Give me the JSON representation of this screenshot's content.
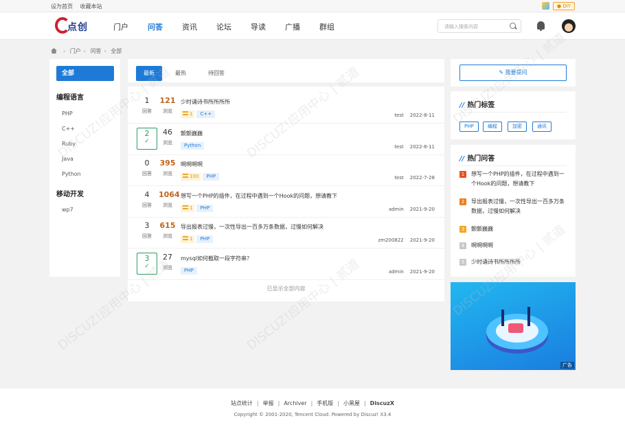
{
  "topbar": {
    "set_home": "设为首页",
    "bookmark": "收藏本站",
    "diy": "● DIY"
  },
  "logo": {
    "text": "点创"
  },
  "nav": [
    {
      "label": "门户",
      "active": false
    },
    {
      "label": "问答",
      "active": true
    },
    {
      "label": "资讯",
      "active": false
    },
    {
      "label": "论坛",
      "active": false
    },
    {
      "label": "导读",
      "active": false
    },
    {
      "label": "广播",
      "active": false
    },
    {
      "label": "群组",
      "active": false
    }
  ],
  "search": {
    "placeholder": "请输入搜索内容"
  },
  "breadcrumb": [
    "门户",
    "问答",
    "全部"
  ],
  "left": {
    "all": "全部",
    "groups": [
      {
        "name": "编程语言",
        "items": [
          "PHP",
          "C++",
          "Ruby",
          "Java",
          "Python"
        ]
      },
      {
        "name": "移动开发",
        "items": [
          "wp7"
        ]
      }
    ]
  },
  "tabs": [
    "最新",
    "最热",
    "待回答"
  ],
  "questions": [
    {
      "answers": "1",
      "answers_label": "回答",
      "solved": false,
      "views": "121",
      "views_label": "浏览",
      "title": "少时诵诗书所所所所",
      "reward": "1",
      "tags": [
        "C++"
      ],
      "author": "test",
      "date": "2022-8-11"
    },
    {
      "answers": "2",
      "answers_label": "✓",
      "solved": true,
      "views": "46",
      "views_label": "浏览",
      "title": "颤颤巍巍",
      "reward": "",
      "tags": [
        "Python"
      ],
      "author": "test",
      "date": "2022-8-11"
    },
    {
      "answers": "0",
      "answers_label": "回答",
      "solved": false,
      "views": "395",
      "views_label": "浏览",
      "title": "啊啊啊啊",
      "reward": "100",
      "tags": [
        "PHP"
      ],
      "author": "test",
      "date": "2022-7-28"
    },
    {
      "answers": "4",
      "answers_label": "回答",
      "solved": false,
      "views": "1064",
      "views_label": "浏览",
      "title": "想写一个PHP的插件，在过程中遇到一个Hook的问题，想请教下",
      "reward": "1",
      "tags": [
        "PHP"
      ],
      "author": "admin",
      "date": "2021-9-20"
    },
    {
      "answers": "3",
      "answers_label": "回答",
      "solved": false,
      "views": "615",
      "views_label": "浏览",
      "title": "导出报表过慢，一次性导出一百多万条数据，过慢如何解决",
      "reward": "1",
      "tags": [
        "PHP"
      ],
      "author": "zm200822",
      "date": "2021-9-20"
    },
    {
      "answers": "3",
      "answers_label": "✓",
      "solved": true,
      "views": "27",
      "views_label": "浏览",
      "title": "mysql如何截取一段字符串？",
      "reward": "",
      "tags": [
        "PHP"
      ],
      "author": "admin",
      "date": "2021-9-20"
    }
  ],
  "all_shown": "已显示全部内容",
  "right": {
    "ask_button": "我要提问",
    "hot_tags_title": "热门标签",
    "hot_tags": [
      "PHP",
      "编程",
      "加密",
      "通讯"
    ],
    "hot_q_title": "热门问答",
    "hot_questions": [
      {
        "rank": "1",
        "text": "想写一个PHP的插件，在过程中遇到一个Hook的问题，想请教下",
        "color": "#e84e1c"
      },
      {
        "rank": "2",
        "text": "导出报表过慢，一次性导出一百多万条数据，过慢如何解决",
        "color": "#f07d1a"
      },
      {
        "rank": "3",
        "text": "颤颤巍巍",
        "color": "#f5a623"
      },
      {
        "rank": "4",
        "text": "啊啊啊啊",
        "color": "#c8c8c8"
      },
      {
        "rank": "5",
        "text": "少时诵诗书所所所所",
        "color": "#c8c8c8"
      }
    ],
    "ad_label": "广告"
  },
  "footer": {
    "links": [
      "站点统计",
      "举报",
      "Archiver",
      "手机版",
      "小黑屋"
    ],
    "brand": "DiscuzX",
    "copyright": "Copyright © 2001-2020, Tencent Cloud.   Powered by Discuz! X3.4"
  },
  "watermark": "DISCUZ!应用中心 | 贰道"
}
